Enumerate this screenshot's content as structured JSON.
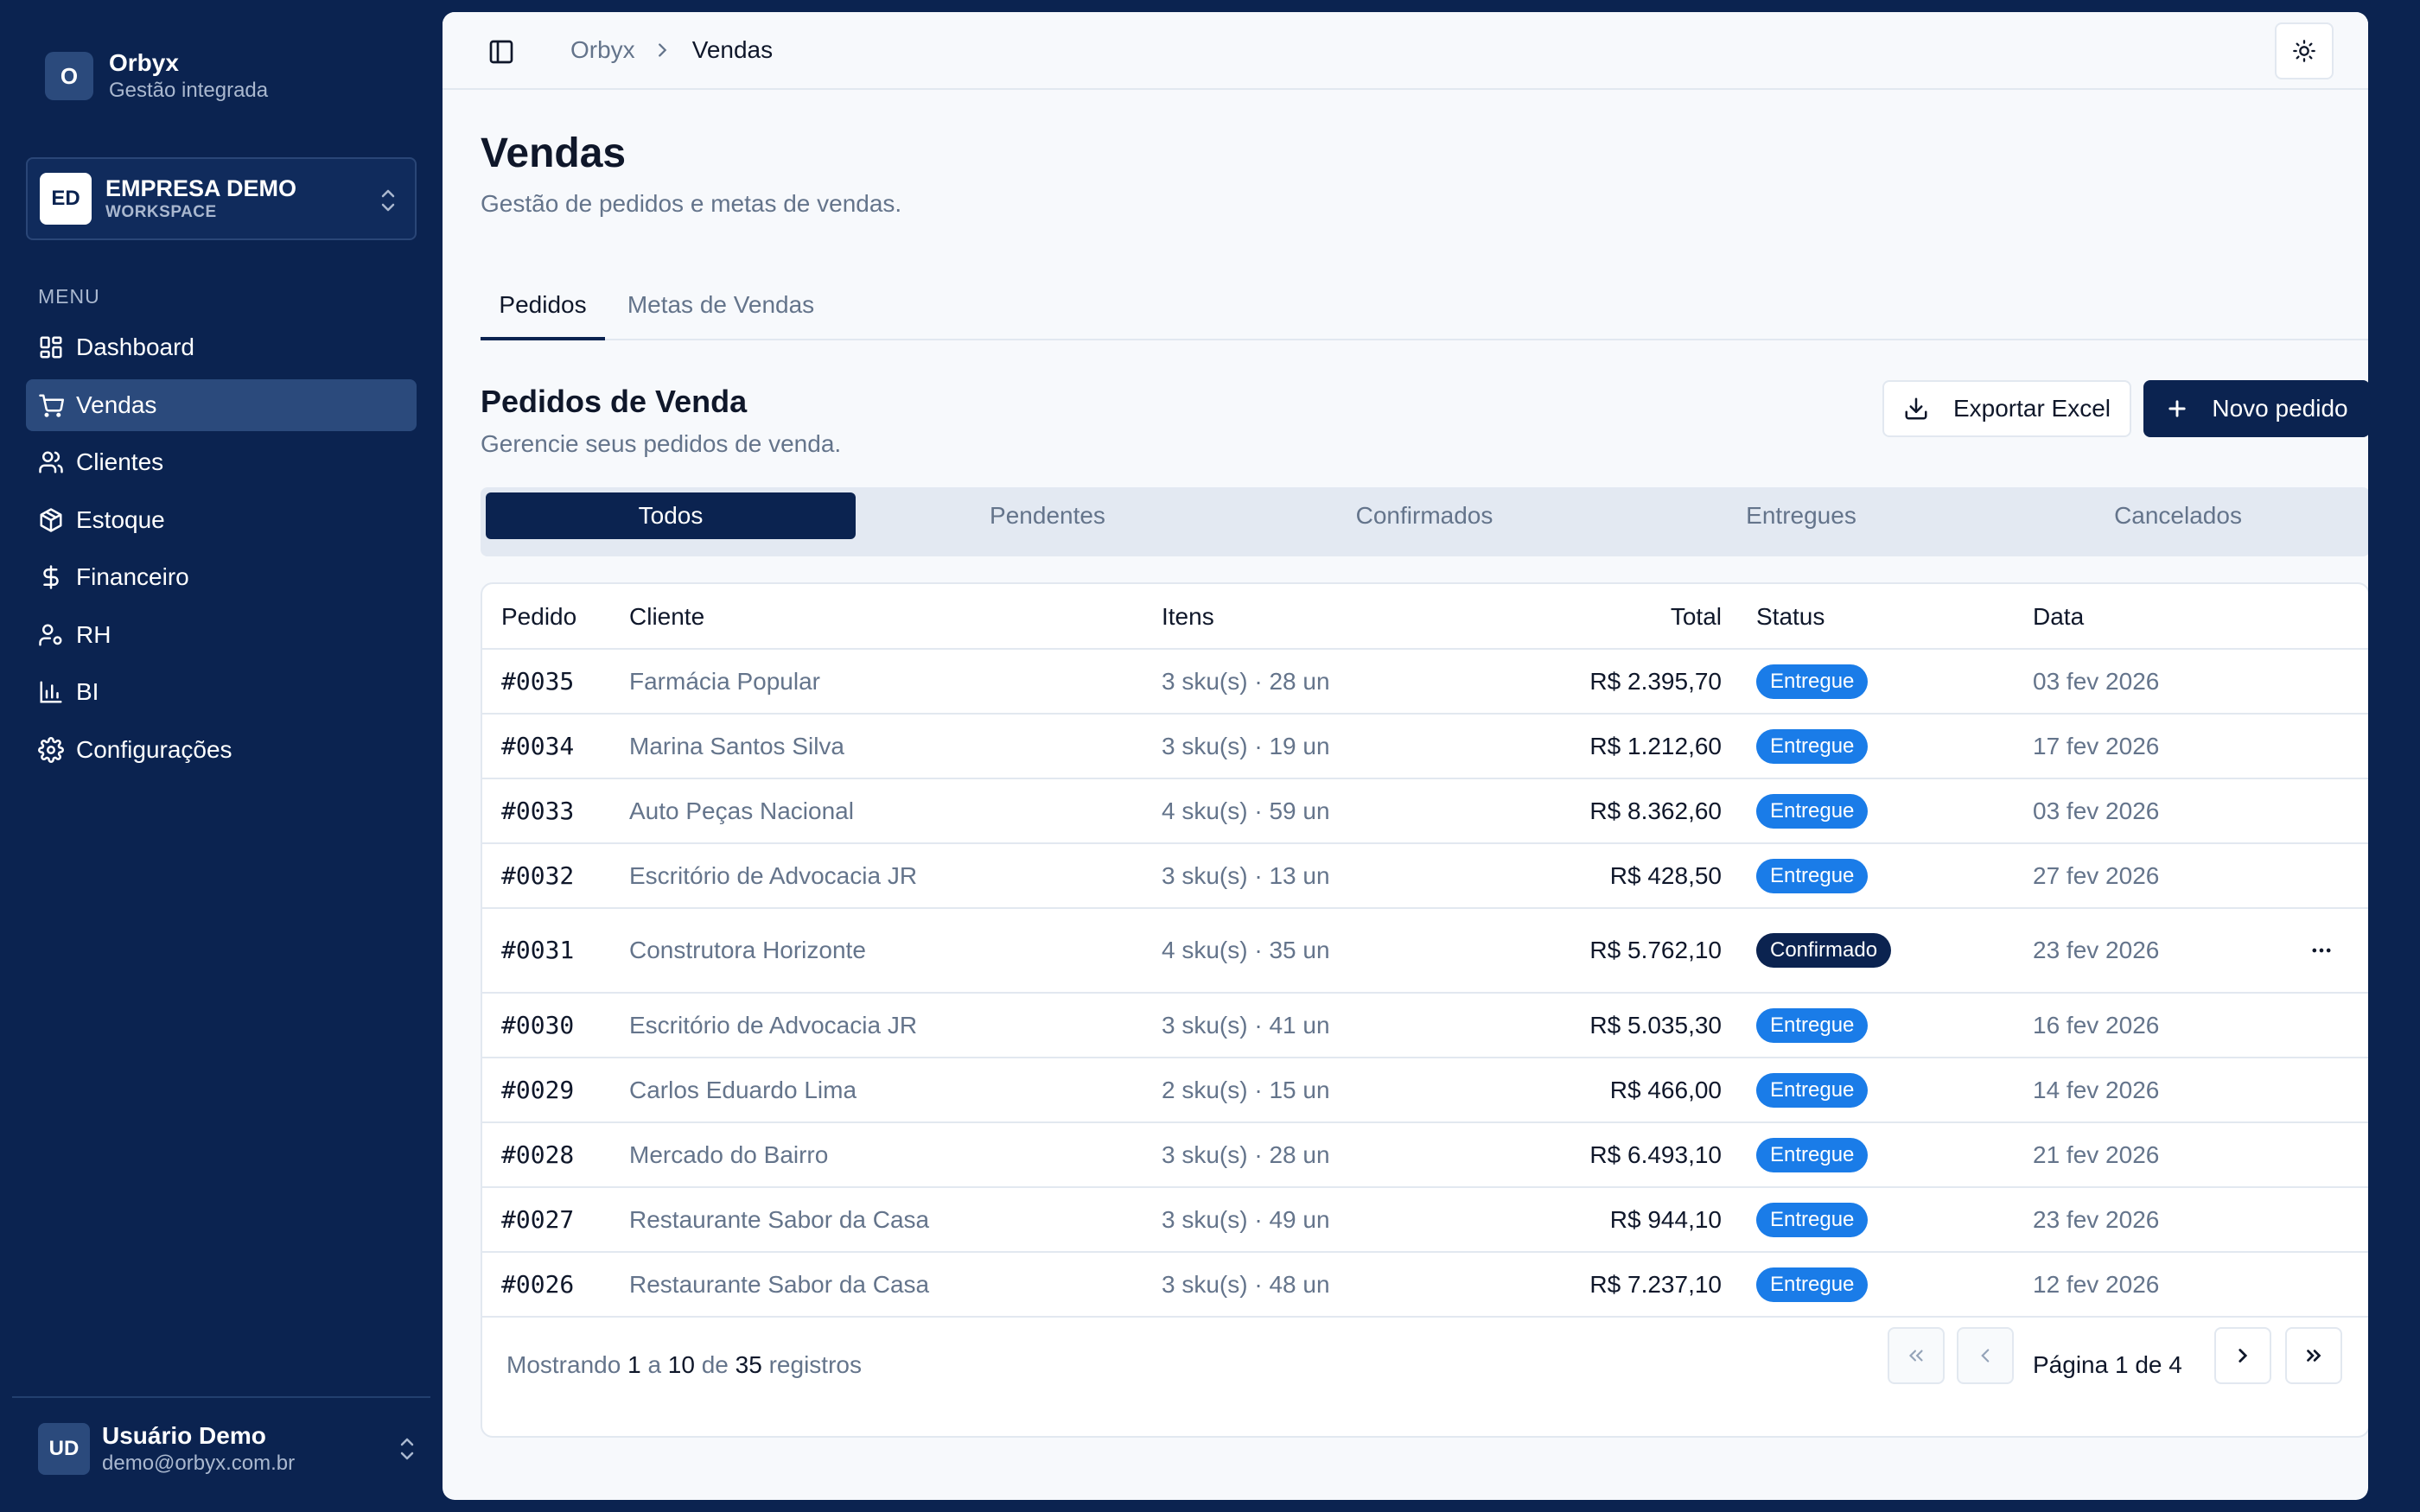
{
  "brand": {
    "logo": "O",
    "name": "Orbyx",
    "subtitle": "Gestão integrada"
  },
  "workspace": {
    "logo": "ED",
    "name": "EMPRESA DEMO",
    "subtitle": "WORKSPACE"
  },
  "menu": {
    "label": "MENU",
    "items": [
      {
        "label": "Dashboard",
        "icon": "dashboard-icon"
      },
      {
        "label": "Vendas",
        "icon": "cart-icon",
        "active": true
      },
      {
        "label": "Clientes",
        "icon": "users-icon"
      },
      {
        "label": "Estoque",
        "icon": "box-icon"
      },
      {
        "label": "Financeiro",
        "icon": "dollar-icon"
      },
      {
        "label": "RH",
        "icon": "user-cog-icon"
      },
      {
        "label": "BI",
        "icon": "bar-chart-icon"
      },
      {
        "label": "Configurações",
        "icon": "gear-icon"
      }
    ]
  },
  "user": {
    "initials": "UD",
    "name": "Usuário Demo",
    "email": "demo@orbyx.com.br"
  },
  "breadcrumb": {
    "root": "Orbyx",
    "current": "Vendas"
  },
  "page": {
    "title": "Vendas",
    "subtitle": "Gestão de pedidos e metas de vendas."
  },
  "tabs": [
    {
      "label": "Pedidos",
      "active": true
    },
    {
      "label": "Metas de Vendas",
      "active": false
    }
  ],
  "section": {
    "title": "Pedidos de Venda",
    "subtitle": "Gerencie seus pedidos de venda.",
    "export_label": "Exportar Excel",
    "new_label": "Novo pedido"
  },
  "filters": [
    {
      "label": "Todos",
      "active": true
    },
    {
      "label": "Pendentes"
    },
    {
      "label": "Confirmados"
    },
    {
      "label": "Entregues"
    },
    {
      "label": "Cancelados"
    }
  ],
  "table": {
    "headers": {
      "id": "Pedido",
      "client": "Cliente",
      "items": "Itens",
      "total": "Total",
      "status": "Status",
      "date": "Data"
    },
    "rows": [
      {
        "id": "#0035",
        "client": "Farmácia Popular",
        "items": "3 sku(s) · 28 un",
        "total": "R$ 2.395,70",
        "status": "Entregue",
        "date": "03 fev 2026"
      },
      {
        "id": "#0034",
        "client": "Marina Santos Silva",
        "items": "3 sku(s) · 19 un",
        "total": "R$ 1.212,60",
        "status": "Entregue",
        "date": "17 fev 2026"
      },
      {
        "id": "#0033",
        "client": "Auto Peças Nacional",
        "items": "4 sku(s) · 59 un",
        "total": "R$ 8.362,60",
        "status": "Entregue",
        "date": "03 fev 2026"
      },
      {
        "id": "#0032",
        "client": "Escritório de Advocacia JR",
        "items": "3 sku(s) · 13 un",
        "total": "R$ 428,50",
        "status": "Entregue",
        "date": "27 fev 2026"
      },
      {
        "id": "#0031",
        "client": "Construtora Horizonte",
        "items": "4 sku(s) · 35 un",
        "total": "R$ 5.762,10",
        "status": "Confirmado",
        "date": "23 fev 2026",
        "menu": true
      },
      {
        "id": "#0030",
        "client": "Escritório de Advocacia JR",
        "items": "3 sku(s) · 41 un",
        "total": "R$ 5.035,30",
        "status": "Entregue",
        "date": "16 fev 2026"
      },
      {
        "id": "#0029",
        "client": "Carlos Eduardo Lima",
        "items": "2 sku(s) · 15 un",
        "total": "R$ 466,00",
        "status": "Entregue",
        "date": "14 fev 2026"
      },
      {
        "id": "#0028",
        "client": "Mercado do Bairro",
        "items": "3 sku(s) · 28 un",
        "total": "R$ 6.493,10",
        "status": "Entregue",
        "date": "21 fev 2026"
      },
      {
        "id": "#0027",
        "client": "Restaurante Sabor da Casa",
        "items": "3 sku(s) · 49 un",
        "total": "R$ 944,10",
        "status": "Entregue",
        "date": "23 fev 2026"
      },
      {
        "id": "#0026",
        "client": "Restaurante Sabor da Casa",
        "items": "3 sku(s) · 48 un",
        "total": "R$ 7.237,10",
        "status": "Entregue",
        "date": "12 fev 2026"
      }
    ]
  },
  "pagination": {
    "prefix": "Mostrando",
    "from": "1",
    "word_to": "a",
    "to": "10",
    "word_of": "de",
    "total": "35",
    "suffix": "registros",
    "page_label": "Página 1 de 4"
  },
  "colors": {
    "sidebar_bg": "#0b2350",
    "accent": "#0b2350",
    "badge_entregue": "#1a7ce8",
    "badge_confirmado": "#0b2350"
  }
}
